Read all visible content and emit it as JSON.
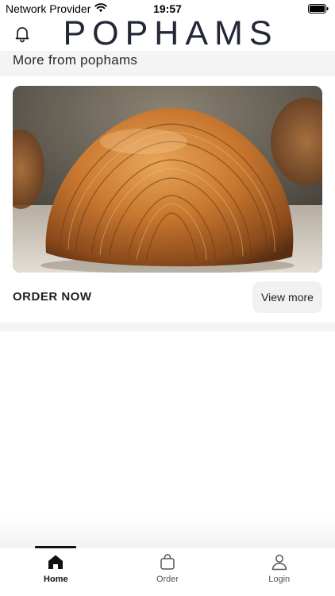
{
  "status_bar": {
    "carrier": "Network Provider",
    "time": "19:57",
    "wifi_icon": "wifi-icon",
    "battery_icon": "battery-icon"
  },
  "header": {
    "brand": "POPHAMS",
    "notification_icon": "bell-icon"
  },
  "section": {
    "title": "More from pophams"
  },
  "card": {
    "image": "croissant-photo",
    "cta_label": "ORDER NOW",
    "button_label": "View more"
  },
  "tabbar": {
    "items": [
      {
        "label": "Home",
        "icon": "home-icon",
        "active": true
      },
      {
        "label": "Order",
        "icon": "bag-icon",
        "active": false
      },
      {
        "label": "Login",
        "icon": "user-icon",
        "active": false
      }
    ]
  },
  "colors": {
    "brand": "#222836",
    "section_bg": "#f4f4f5",
    "button_bg": "#f1f1f2"
  }
}
